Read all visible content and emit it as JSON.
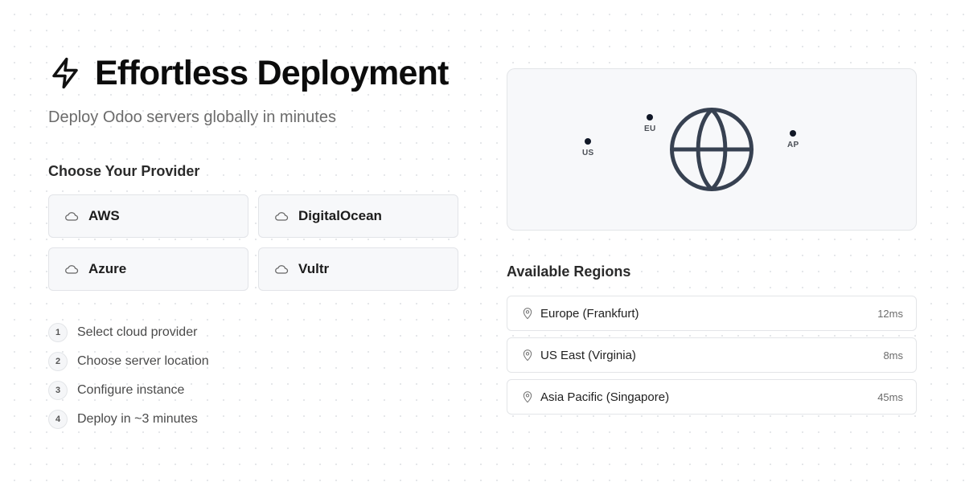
{
  "hero": {
    "title": "Effortless Deployment",
    "subtitle": "Deploy Odoo servers globally in minutes",
    "icon": "bolt-icon"
  },
  "providers": {
    "heading": "Choose Your Provider",
    "items": [
      {
        "label": "AWS",
        "icon": "cloud-icon"
      },
      {
        "label": "DigitalOcean",
        "icon": "cloud-icon"
      },
      {
        "label": "Azure",
        "icon": "cloud-icon"
      },
      {
        "label": "Vultr",
        "icon": "cloud-icon"
      }
    ]
  },
  "steps": [
    {
      "num": "1",
      "text": "Select cloud provider"
    },
    {
      "num": "2",
      "text": "Choose server location"
    },
    {
      "num": "3",
      "text": "Configure instance"
    },
    {
      "num": "4",
      "text": "Deploy in ~3 minutes"
    }
  ],
  "map": {
    "icon": "globe-icon",
    "markers": [
      {
        "label": "US"
      },
      {
        "label": "EU"
      },
      {
        "label": "AP"
      }
    ]
  },
  "regions": {
    "heading": "Available Regions",
    "items": [
      {
        "name": "Europe (Frankfurt)",
        "latency": "12ms",
        "icon": "map-pin-icon"
      },
      {
        "name": "US East (Virginia)",
        "latency": "8ms",
        "icon": "map-pin-icon"
      },
      {
        "name": "Asia Pacific (Singapore)",
        "latency": "45ms",
        "icon": "map-pin-icon"
      }
    ]
  },
  "colors": {
    "accent": "#111827",
    "card_bg": "#f7f8fa",
    "border": "#e3e5e8",
    "muted_text": "#6b6b6b"
  }
}
